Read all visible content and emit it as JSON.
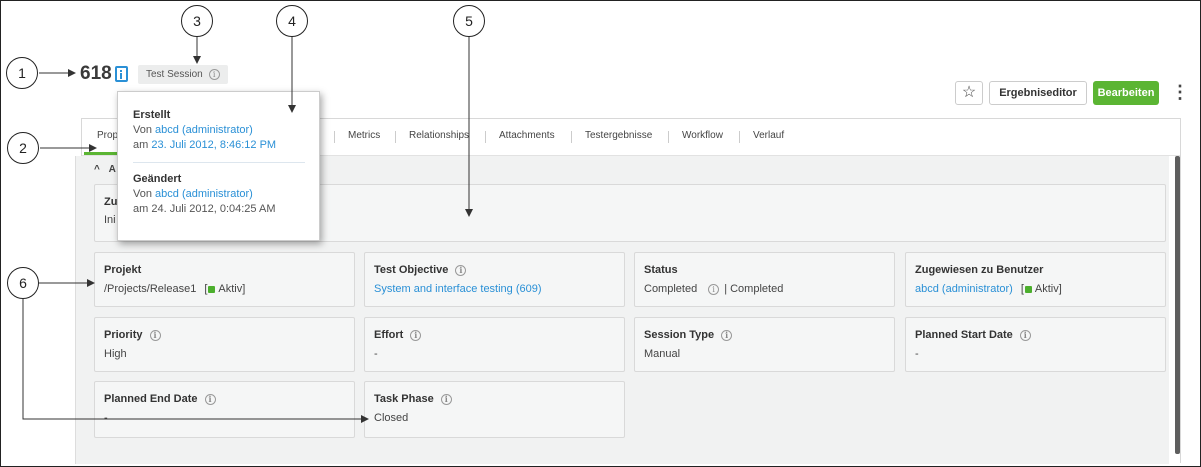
{
  "header": {
    "record_id": "618",
    "type_badge": "Test Session",
    "favorite_icon": "star-icon",
    "editor_button": "Ergebniseditor",
    "edit_button": "Bearbeiten",
    "more_icon": "kebab-menu-icon"
  },
  "tabs": [
    {
      "label": "Prop"
    },
    {
      "label": "Metrics"
    },
    {
      "label": "Relationships"
    },
    {
      "label": "Attachments"
    },
    {
      "label": "Testergebnisse"
    },
    {
      "label": "Workflow"
    },
    {
      "label": "Verlauf"
    }
  ],
  "section": {
    "chevron": "^",
    "title": "A",
    "wide_label": "Zu",
    "wide_value": "Ini"
  },
  "fields": [
    {
      "label": "Projekt",
      "value": "/Projects/Release1",
      "suffix_open": "[",
      "status": "Aktiv",
      "suffix_close": "]"
    },
    {
      "label": "Test Objective",
      "value": "System and interface testing (609)"
    },
    {
      "label": "Status",
      "value": "Completed",
      "value2": "| Completed"
    },
    {
      "label": "Zugewiesen zu Benutzer",
      "value": "abcd (administrator)",
      "suffix_open": "[",
      "status": "Aktiv",
      "suffix_close": "]"
    },
    {
      "label": "Priority",
      "value": "High"
    },
    {
      "label": "Effort",
      "value": "-"
    },
    {
      "label": "Session Type",
      "value": "Manual"
    },
    {
      "label": "Planned Start Date",
      "value": "-"
    },
    {
      "label": "Planned End Date",
      "value": "-"
    },
    {
      "label": "Task Phase",
      "value": "Closed"
    }
  ],
  "popover": {
    "created_title": "Erstellt",
    "created_by_prefix": "Von",
    "created_by": "abcd (administrator)",
    "created_on_prefix": "am",
    "created_on": "23. Juli 2012, 8:46:12 PM",
    "changed_title": "Geändert",
    "changed_by_prefix": "Von",
    "changed_by": "abcd (administrator)",
    "changed_on_prefix": "am",
    "changed_on": "24. Juli 2012, 0:04:25 AM"
  },
  "callouts": [
    "1",
    "2",
    "3",
    "4",
    "5",
    "6"
  ],
  "colors": {
    "accent_green": "#5bb533",
    "link_blue": "#2a90d6",
    "status_green": "#4caf2d"
  }
}
